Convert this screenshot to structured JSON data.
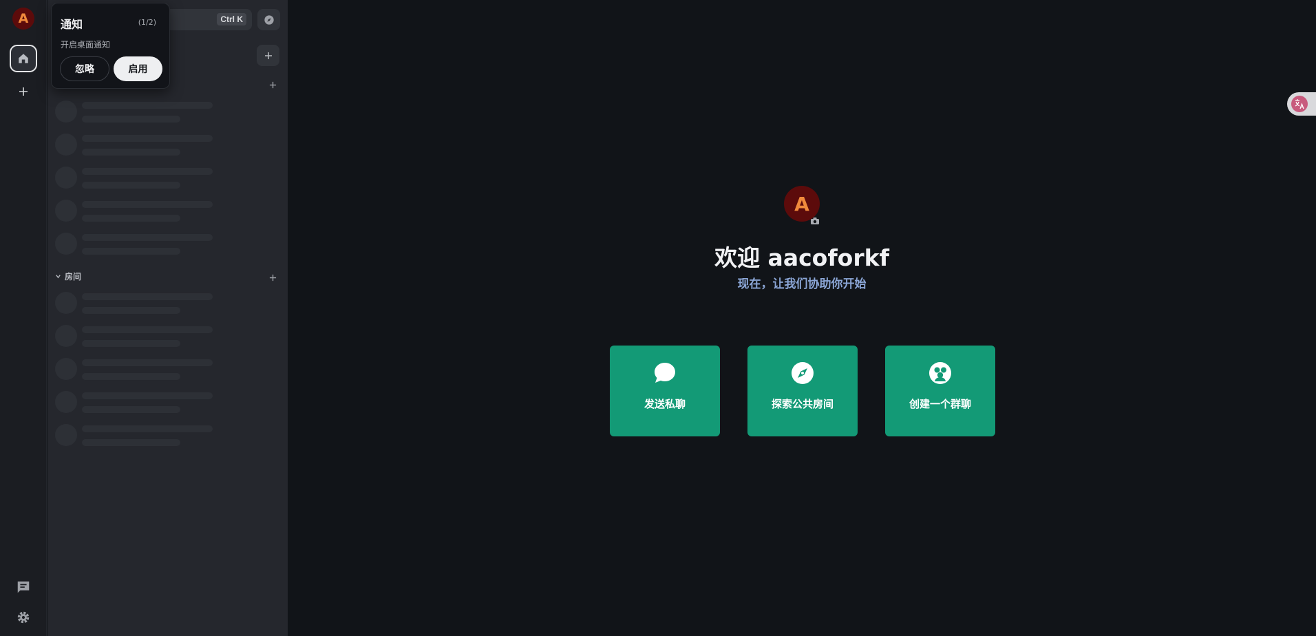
{
  "rail": {
    "avatar_letter": "A"
  },
  "search": {
    "shortcut": "Ctrl K"
  },
  "notification": {
    "title": "通知",
    "count": "(1/2)",
    "message": "开启桌面通知",
    "ignore_label": "忽略",
    "enable_label": "启用"
  },
  "sidebar": {
    "rooms_section_label": "房间"
  },
  "main": {
    "avatar_letter": "A",
    "welcome": "欢迎 aacoforkf",
    "subtitle": "现在，让我们协助你开始",
    "cards": [
      {
        "label": "发送私聊",
        "icon": "chat-bubble-icon"
      },
      {
        "label": "探索公共房间",
        "icon": "compass-icon"
      },
      {
        "label": "创建一个群聊",
        "icon": "group-icon"
      }
    ]
  },
  "colors": {
    "accent_green": "#139a76",
    "avatar_bg": "#5c0b0b",
    "avatar_letter": "#f08a3c",
    "subtitle_blue": "#8ba6d6"
  }
}
